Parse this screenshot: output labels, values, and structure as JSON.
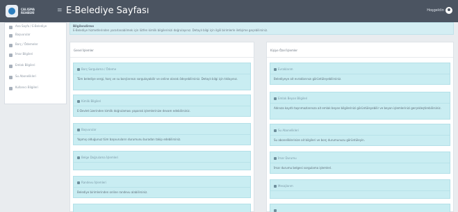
{
  "app": {
    "logo_text": "ÇALIŞMA REHBERİ",
    "title": "E-Belediye Sayfası",
    "user_label": "Hoşgeldin"
  },
  "sidebar": {
    "items": [
      {
        "label": "Ana Sayfa / E-Belediye",
        "icon": "home-icon"
      },
      {
        "label": "Başvurular",
        "icon": "file-icon"
      },
      {
        "label": "Borç / Ödemeler",
        "icon": "money-icon"
      },
      {
        "label": "İmar Bilgileri",
        "icon": "map-icon"
      },
      {
        "label": "Emlak Bilgileri",
        "icon": "building-icon"
      },
      {
        "label": "Su Abonelikleri",
        "icon": "water-icon"
      },
      {
        "label": "Kullanıcı Bilgileri",
        "icon": "user-icon"
      }
    ]
  },
  "notice": {
    "title": "Bilgilendirme",
    "text": "E-Belediye hizmetlerinden yararlanabilmek için lütfen kimlik bilgilerinizi doğrulayınız. Detaylı bilgi için ilgili birimlerle iletişime geçebilirsiniz."
  },
  "left_panel": {
    "title": "Genel İşlemler",
    "cards": [
      {
        "title": "Borç Sorgulama / Ödeme",
        "body": "Tüm belediye vergi, harç ve su borçlarınızı sorgulayabilir ve online olarak ödeyebilirsiniz. Detaylı bilgi için tıklayınız."
      },
      {
        "title": "Kimlik Bilgileri",
        "body": "E-Devlet üzerinden kimlik doğrulaması yaparak işlemlerinize devam edebilirsiniz."
      },
      {
        "title": "Başvurular",
        "body": "Yapmış olduğunuz tüm başvuruların durumunu buradan takip edebilirsiniz."
      },
      {
        "title": "Belge Doğrulama İşlemleri",
        "body": ""
      },
      {
        "title": "Randevu İşlemleri",
        "body": "Belediye birimlerinden online randevu alabilirsiniz."
      },
      {
        "title": "",
        "body": ""
      }
    ]
  },
  "right_panel": {
    "title": "Kişiye Özel İşlemler",
    "cards": [
      {
        "title": "Evraklarım",
        "body": "Belediyeye ait evraklarınızı görüntüleyebilirsiniz."
      },
      {
        "title": "Emlak Beyan Bilgileri",
        "body": "Adınıza kayıtlı taşınmazlarınıza ait emlak beyan bilgilerinizi görüntüleyebilir ve beyan işlemlerinizi gerçekleştirebilirsiniz."
      },
      {
        "title": "Su Abonelikleri",
        "body": "Su aboneliklerinize ait bilgileri ve borç durumunuzu görüntüleyin."
      },
      {
        "title": "İmar Durumu",
        "body": "İmar durumu belgesi sorgulama işlemleri."
      },
      {
        "title": "Mesajlarım",
        "body": ""
      },
      {
        "title": "",
        "body": ""
      }
    ]
  }
}
